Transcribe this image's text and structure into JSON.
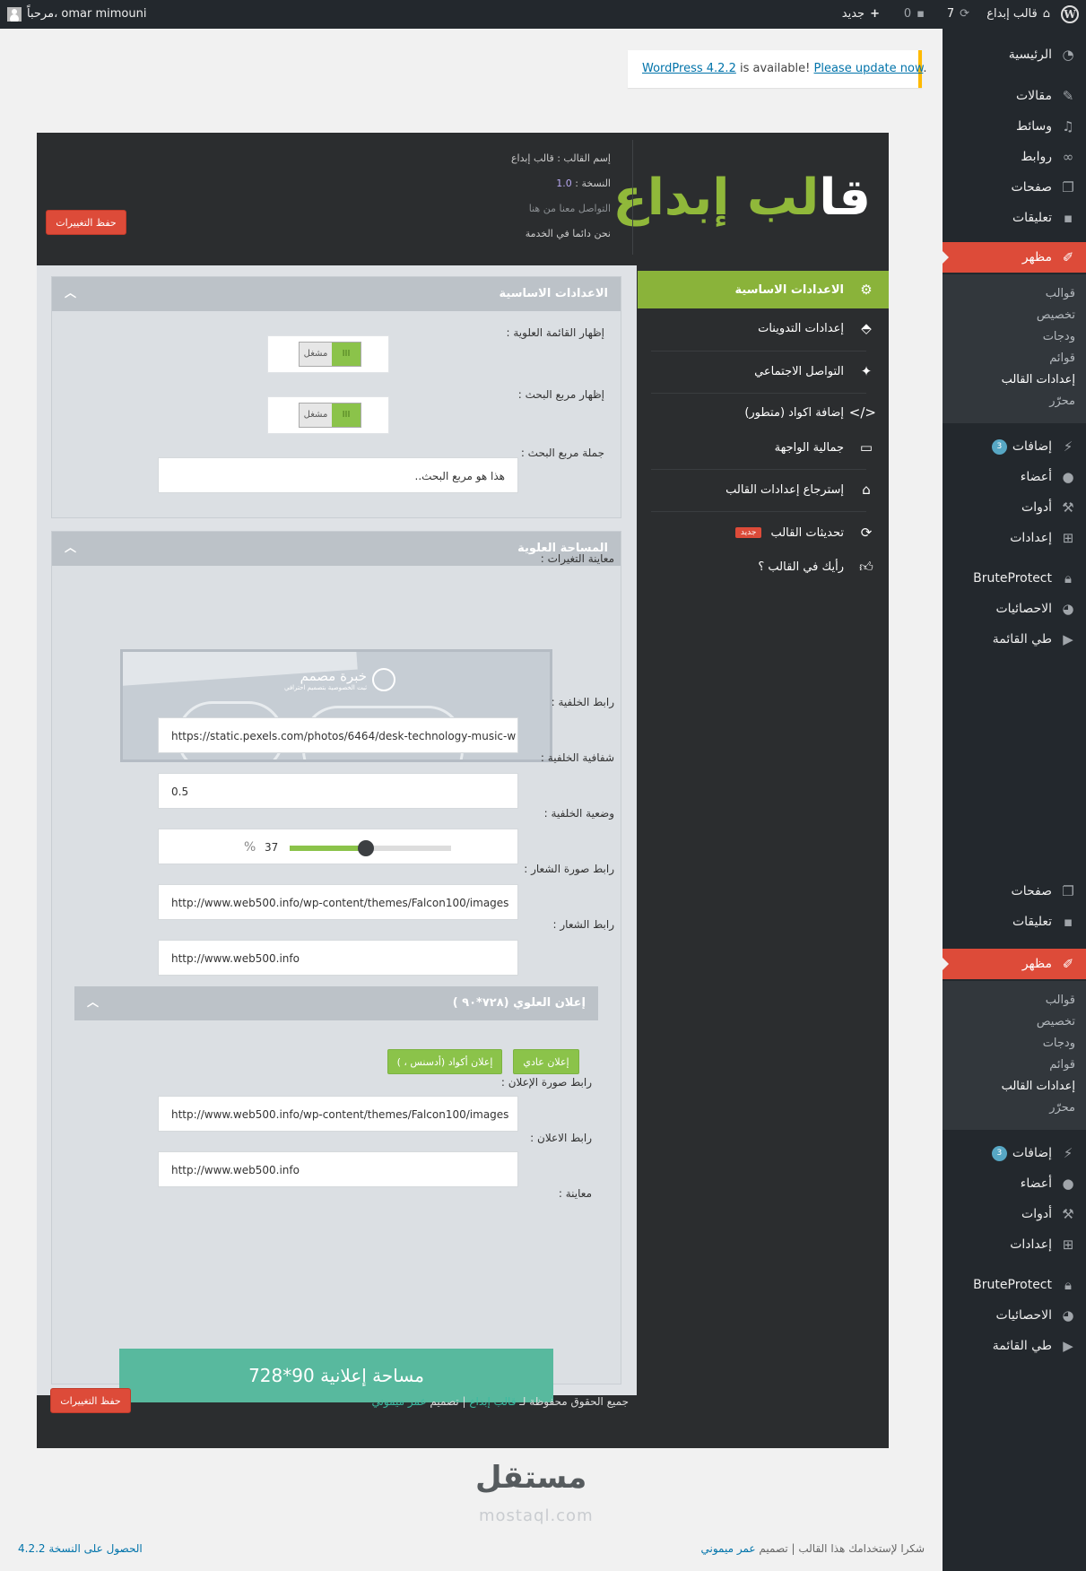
{
  "adminbar": {
    "site_name": "قالب إبداع",
    "updates_count": "7",
    "comments_count": "0",
    "new_label": "جديد",
    "greeting": "مرحباً، omar mimouni"
  },
  "notice": {
    "link_version": "WordPress 4.2.2",
    "middle": " is available! ",
    "update_link": "Please update now",
    "end": "."
  },
  "menu": {
    "dashboard": "الرئيسية",
    "posts": "مقالات",
    "media": "وسائط",
    "links": "روابط",
    "pages": "صفحات",
    "comments": "تعليقات",
    "appearance": "مظهر",
    "themes": "قوالب",
    "customize": "تخصيص",
    "widgets": "ودجات",
    "menus": "قوائم",
    "theme_settings": "إعدادات القالب",
    "editor": "محرّر",
    "plugins": "إضافات",
    "plugins_badge": "3",
    "users": "أعضاء",
    "tools": "أدوات",
    "settings": "إعدادات",
    "bruteprotect": "BruteProtect",
    "stats": "الاحصائيات",
    "collapse": "طي القائمة"
  },
  "theme": {
    "logo_white": "قا",
    "logo_green": "لب إبداع",
    "name_label": "إسم القالب : قالب إبداع",
    "version_label": "النسخة : ",
    "version_value": "1.0",
    "contact": "التواصل معنا من هنا",
    "service": "نحن دائما في الخدمة",
    "save_label": "حفظ التغييرات"
  },
  "nav": {
    "basic": "الاعدادات الاساسية",
    "posts": "إعدادات التدوينات",
    "social": "التواصل الاجتماعي",
    "codes": "إضافة اكواد (متطور)",
    "appearance": "جمالية الواجهة",
    "restore": "إسترجاع إعدادات القالب",
    "updates": "تحديثات القالب",
    "updates_badge": "جديد",
    "opinion": "رأيك في القالب ؟"
  },
  "basic": {
    "title": "الاعدادات الاساسية",
    "show_top_menu": "إظهار القائمة العلوية :",
    "show_search": "إظهار مربع البحث :",
    "search_phrase": "جملة مربع البحث :",
    "search_phrase_value": "هذا هو مربع البحث..",
    "toggle_label": "مشغل",
    "toggle_on": "III"
  },
  "top": {
    "title": "المساحة العلوية",
    "preview_label": "معاينة التغيرات :",
    "preview_brand": "خبرة مصمم",
    "preview_tagline": "ثبت الخصوصية بتصميم احترافي",
    "bg_url_label": "رابط الخلفية :",
    "bg_url_value": "https://static.pexels.com/photos/6464/desk-technology-music-w",
    "bg_opacity_label": "شفافية الخلفية :",
    "bg_opacity_value": "0.5",
    "bg_position_label": "وضعية الخلفية :",
    "bg_position_value": "37",
    "bg_position_unit": "%",
    "bg_position_fraction": 0.37,
    "logo_img_label": "رابط صورة الشعار :",
    "logo_img_value": "http://www.web500.info/wp-content/themes/Falcon100/images",
    "logo_url_label": "رابط الشعار :",
    "logo_url_value": "http://www.web500.info"
  },
  "ad": {
    "title": "إعلان العلوي (٧٢٨*٩٠ )",
    "normal_btn": "إعلان عادي",
    "code_btn": "إعلان أكواد (أدسنس ، )",
    "img_label": "رابط صورة الإعلان :",
    "img_value": "http://www.web500.info/wp-content/themes/Falcon100/images",
    "url_label": "رابط الاعلان :",
    "url_value": "http://www.web500.info",
    "preview_label": "معاينة :",
    "preview_box": "مساحة إعلانية 90*728"
  },
  "footer": {
    "rights": "جميع الحقوق محفوظة لـ ",
    "theme_link": "قالب إبداع",
    "design": " | تصميم ",
    "designer": "عمر ميموني",
    "watermark": "مستقل",
    "watermark_url": "mostaql.com",
    "wp_thanks": "شكرا لإستخدامك هذا القالب | تصميم ",
    "wp_designer": "عمر ميموني",
    "version_link": "الحصول على النسخة 4.2.2"
  },
  "colors": {
    "accent_green": "#8ab33a",
    "red": "#dd4b39",
    "dark": "#2b2d2f",
    "ad_teal": "#58b99e"
  }
}
